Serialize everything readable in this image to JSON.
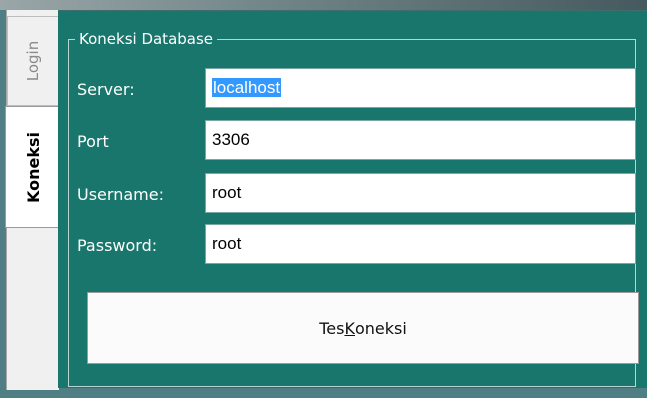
{
  "tabs": {
    "login": "Login",
    "koneksi": "Koneksi"
  },
  "group": {
    "title": "Koneksi Database"
  },
  "form": {
    "server_label": "Server:",
    "server_value": "localhost",
    "port_label": "Port",
    "port_value": "3306",
    "username_label": "Username:",
    "username_value": "root",
    "password_label": "Password:",
    "password_value": "root"
  },
  "button": {
    "pre": "Tes ",
    "mnemonic": "K",
    "post": "oneksi"
  },
  "colors": {
    "panel": "#19766c",
    "selection": "#3399ff"
  }
}
